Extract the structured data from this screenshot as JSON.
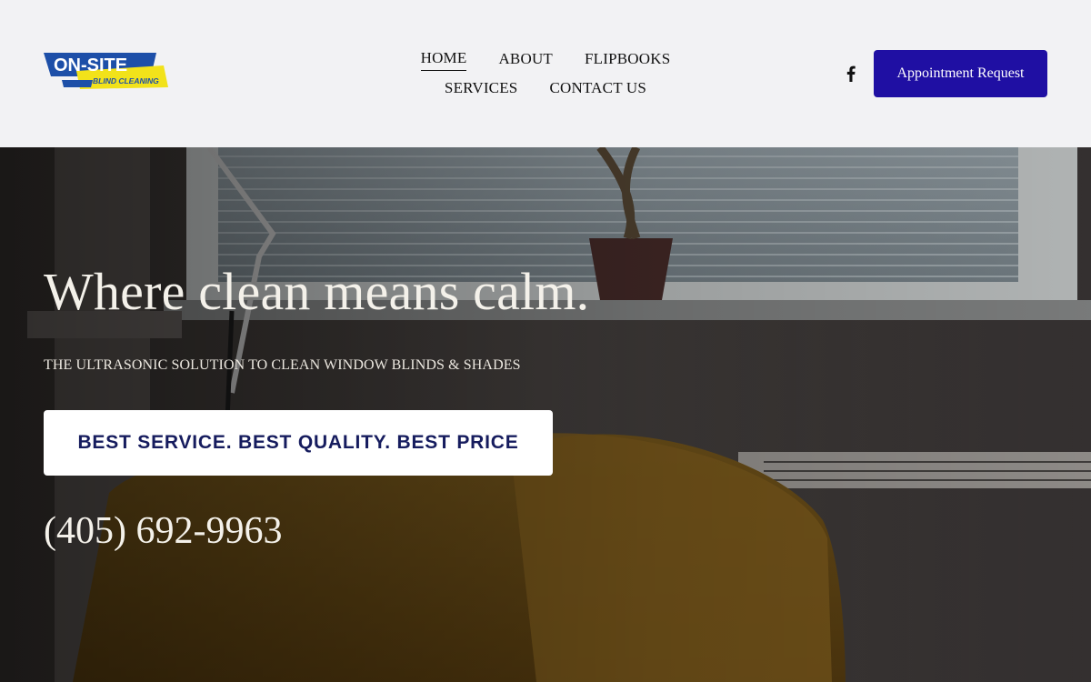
{
  "brand": {
    "logo_main": "ON-SITE",
    "logo_sub": "BLIND CLEANING",
    "colors": {
      "logo_blue": "#1d4fa8",
      "logo_yellow": "#f2e21a"
    }
  },
  "nav": {
    "items": [
      {
        "label": "HOME",
        "active": true
      },
      {
        "label": "ABOUT",
        "active": false
      },
      {
        "label": "FLIPBOOKS",
        "active": false
      },
      {
        "label": "SERVICES",
        "active": false
      },
      {
        "label": "CONTACT US",
        "active": false
      }
    ]
  },
  "social": {
    "icon": "facebook-icon"
  },
  "header": {
    "appointment_label": "Appointment Request",
    "button_color": "#1f0fa3"
  },
  "hero": {
    "title": "Where clean means calm.",
    "subtitle": "THE ULTRASONIC SOLUTION TO CLEAN WINDOW BLINDS & SHADES",
    "cta_label": "BEST SERVICE. BEST QUALITY. BEST PRICE",
    "phone": "(405) 692-9963"
  }
}
